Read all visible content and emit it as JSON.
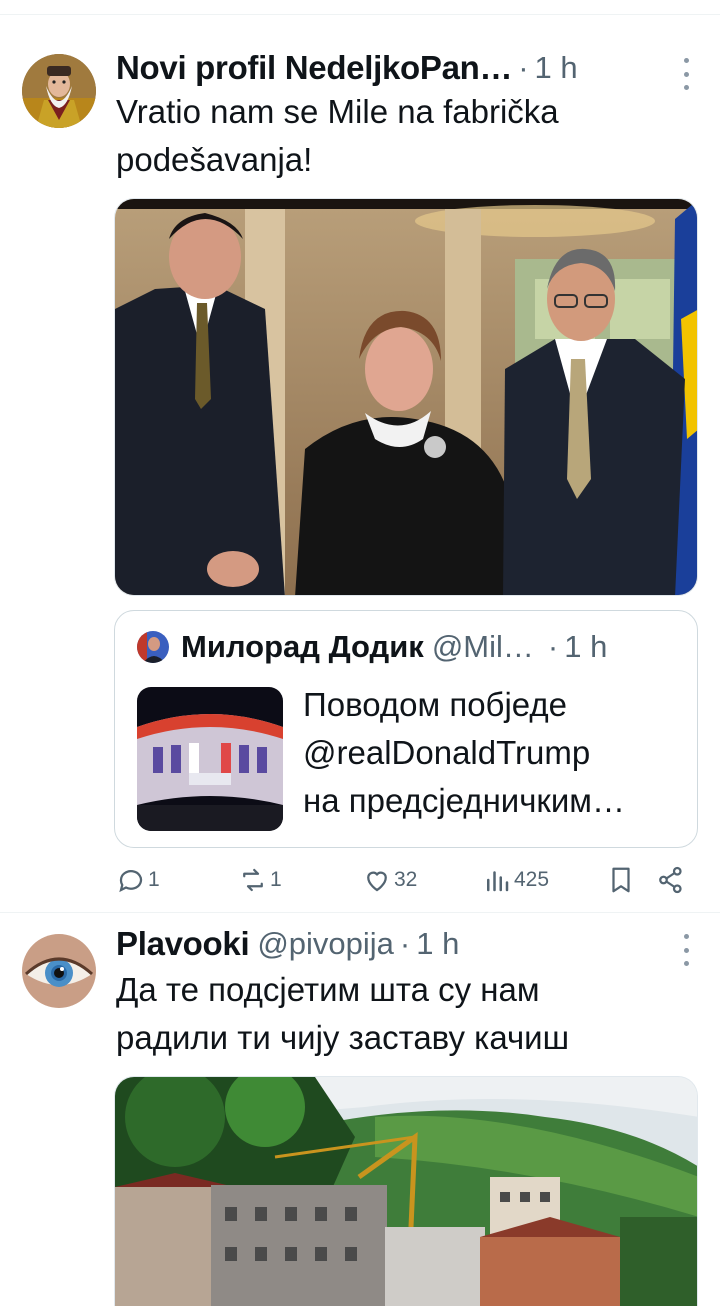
{
  "tweets": [
    {
      "author_name": "Novi profil NedeljkoPan…",
      "handle": "",
      "dot": "·",
      "time": "1 h",
      "avatar_icon": "bearded-man-avatar",
      "text_lines": [
        "Vratio nam se Mile na fabrička",
        "podešavanja!"
      ],
      "quote": {
        "author_name": "Милорад Додик",
        "handle": "@Mil…",
        "dot": "·",
        "time": "1 h",
        "text_lines": [
          "Поводом побједе",
          "@realDonaldTrump",
          "на предсједничким…"
        ]
      },
      "actions": {
        "replies": "1",
        "reposts": "1",
        "likes": "32",
        "views": "425"
      }
    },
    {
      "author_name": "Plavooki",
      "handle": "@pivopija",
      "dot": "·",
      "time": "1 h",
      "avatar_icon": "blue-eye-avatar",
      "text_lines": [
        "Да те подсјетим шта су нам",
        "радили ти чију заставу качиш"
      ]
    }
  ],
  "colors": {
    "text": "#0f1419",
    "secondary": "#536471",
    "border": "#cfd9de",
    "separator": "#eff3f4"
  }
}
